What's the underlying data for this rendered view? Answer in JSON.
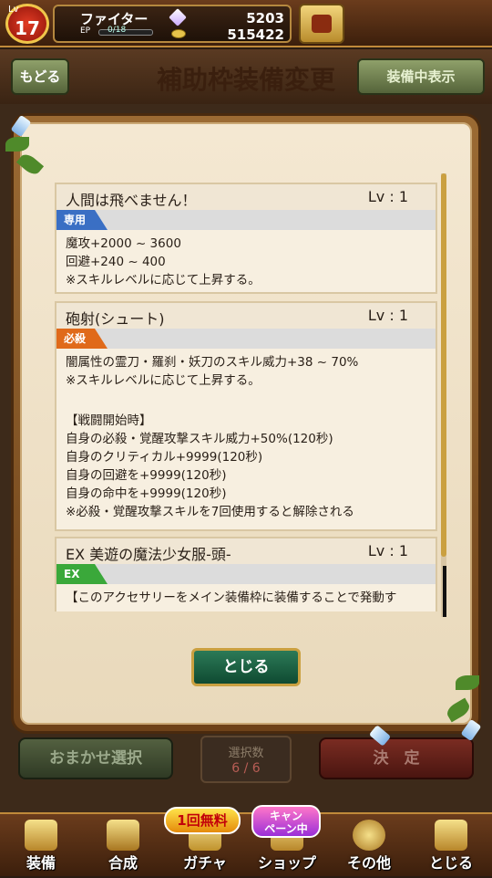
{
  "status": {
    "level_tag": "Lv",
    "level": "17",
    "player_name": "ファイター",
    "ep_label": "EP",
    "ep_text": "0/18",
    "gems": "5203",
    "coins": "515422"
  },
  "header": {
    "back_label": "もどる",
    "title": "補助枠装備変更",
    "show_equipped_label": "装備中表示"
  },
  "skills": [
    {
      "name": "人間は飛べません！",
      "level": "Lv : 1",
      "tag": "専用",
      "tag_color": "#3a6fc4",
      "lines": [
        "魔攻+2000 ~ 3600",
        "回避+240 ~ 400",
        "※スキルレベルに応じて上昇する。"
      ]
    },
    {
      "name": "砲射(シュート)",
      "level": "Lv : 1",
      "tag": "必殺",
      "tag_color": "#e06a1a",
      "lines": [
        "闇属性の霊刀・羅刹・妖刀のスキル威力+38 ~ 70%",
        "※スキルレベルに応じて上昇する。",
        "",
        "【戦闘開始時】",
        "自身の必殺・覚醒攻撃スキル威力+50%(120秒)",
        "自身のクリティカル+9999(120秒)",
        "自身の回避を+9999(120秒)",
        "自身の命中を+9999(120秒)",
        "※必殺・覚醒攻撃スキルを7回使用すると解除される"
      ]
    },
    {
      "name": "EX 美遊の魔法少女服-頭-",
      "level": "Lv : 1",
      "tag": "EX",
      "tag_color": "#3aa83a",
      "lines": [
        "【このアクセサリーをメイン装備枠に装備することで発動す"
      ]
    }
  ],
  "modal": {
    "close_label": "とじる"
  },
  "bottom": {
    "auto_select_label": "おまかせ選択",
    "select_count_label": "選択数",
    "select_count_value": "6 / 6",
    "confirm_label": "決　定"
  },
  "nav": {
    "items": [
      {
        "label": "装備",
        "icon": "equip-icon"
      },
      {
        "label": "合成",
        "icon": "hammer-icon"
      },
      {
        "label": "ガチャ",
        "icon": "gacha-icon"
      },
      {
        "label": "ショップ",
        "icon": "shop-icon"
      },
      {
        "label": "その他",
        "icon": "gear-icon"
      },
      {
        "label": "とじる",
        "icon": "close-icon"
      }
    ],
    "gacha_badge": "1回無料",
    "shop_badge": "キャン\nペーン中"
  }
}
